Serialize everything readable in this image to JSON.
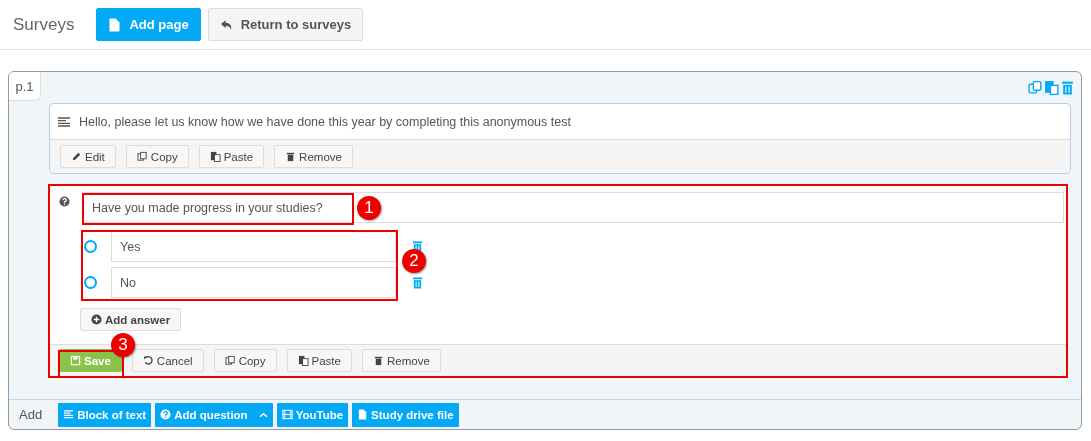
{
  "header": {
    "title": "Surveys",
    "buttons": [
      {
        "label": "Add page",
        "kind": "primary"
      },
      {
        "label": "Return to surveys",
        "kind": "default"
      }
    ]
  },
  "page": {
    "tab": "p.1",
    "text_block": {
      "text": "Hello, please let us know how we have done this year by completing this anonymous test",
      "buttons": [
        "Edit",
        "Copy",
        "Paste",
        "Remove"
      ]
    },
    "question": {
      "text": "Have you made progress in your studies?",
      "answers": [
        {
          "label": "Yes",
          "selected": false
        },
        {
          "label": "No",
          "selected": false
        }
      ],
      "add_answer": "Add answer",
      "buttons": [
        {
          "label": "Save",
          "kind": "success"
        },
        {
          "label": "Cancel",
          "kind": "default"
        },
        {
          "label": "Copy",
          "kind": "default"
        },
        {
          "label": "Paste",
          "kind": "default"
        },
        {
          "label": "Remove",
          "kind": "default"
        }
      ]
    },
    "annotations": [
      "1",
      "2",
      "3"
    ]
  },
  "add_bar": {
    "label": "Add",
    "buttons": [
      {
        "label": "Block of text",
        "dropdown": false
      },
      {
        "label": "Add question",
        "dropdown": true
      },
      {
        "label": "YouTube",
        "dropdown": false
      },
      {
        "label": "Study drive file",
        "dropdown": false
      }
    ]
  }
}
